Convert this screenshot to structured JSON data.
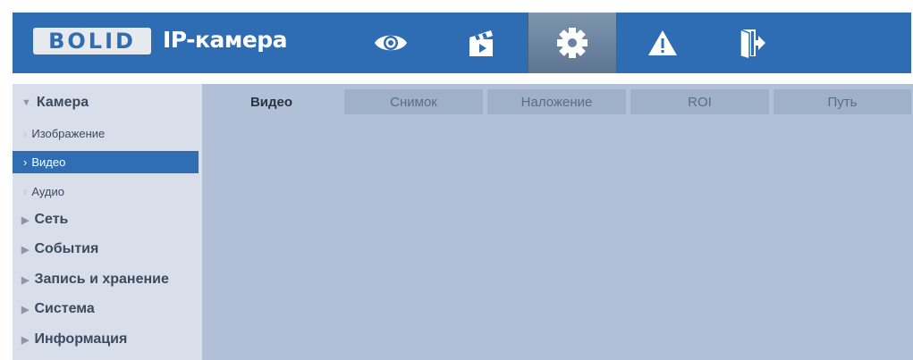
{
  "header": {
    "logo_text": "BOLID",
    "product_title": "IP-камера",
    "nav": [
      {
        "icon": "eye-icon",
        "active": false
      },
      {
        "icon": "clapperboard-icon",
        "active": false
      },
      {
        "icon": "gear-icon",
        "active": true
      },
      {
        "icon": "warning-icon",
        "active": false
      },
      {
        "icon": "exit-icon",
        "active": false
      }
    ]
  },
  "sidebar": {
    "items": [
      {
        "label": "Камера",
        "expanded": true
      },
      {
        "label": "Изображение"
      },
      {
        "label": "Видео",
        "active": true
      },
      {
        "label": "Аудио"
      },
      {
        "label": "Сеть"
      },
      {
        "label": "События"
      },
      {
        "label": "Запись и хранение"
      },
      {
        "label": "Система"
      },
      {
        "label": "Информация"
      }
    ]
  },
  "tabs": [
    {
      "label": "Видео",
      "active": true
    },
    {
      "label": "Снимок"
    },
    {
      "label": "Наложение"
    },
    {
      "label": "ROI"
    },
    {
      "label": "Путь"
    }
  ],
  "colors": {
    "header_bg": "#2e6db3",
    "active_item": "#2f6eb5",
    "content_bg": "#b1c0d7",
    "sidebar_bg": "#d8dfeb"
  }
}
